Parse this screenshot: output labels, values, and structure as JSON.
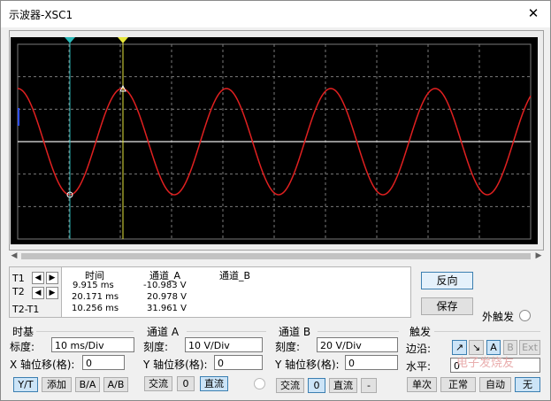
{
  "window": {
    "title": "示波器-XSC1",
    "close": "✕"
  },
  "cursors": {
    "t1_marker": "1",
    "t2_marker": "2"
  },
  "readout": {
    "row_labels": [
      "T1",
      "T2",
      "T2-T1"
    ],
    "headers": {
      "time": "时间",
      "ch_a": "通道_A",
      "ch_b": "通道_B"
    },
    "rows": [
      {
        "time": "9.915 ms",
        "ch_a": "-10.983 V",
        "ch_b": ""
      },
      {
        "time": "20.171 ms",
        "ch_a": "20.978 V",
        "ch_b": ""
      },
      {
        "time": "10.256 ms",
        "ch_a": "31.961 V",
        "ch_b": ""
      }
    ]
  },
  "side_buttons": {
    "reverse": "反向",
    "save": "保存",
    "ext_trigger": "外触发"
  },
  "timebase": {
    "title": "时基",
    "scale_label": "标度:",
    "scale_value": "10 ms/Div",
    "xpos_label": "X 轴位移(格):",
    "xpos_value": "0",
    "modes": [
      "Y/T",
      "添加",
      "B/A",
      "A/B"
    ]
  },
  "channel_a": {
    "title": "通道 A",
    "scale_label": "刻度:",
    "scale_value": "10 V/Div",
    "ypos_label": "Y 轴位移(格):",
    "ypos_value": "0",
    "coupling": [
      "交流",
      "0",
      "直流"
    ]
  },
  "channel_b": {
    "title": "通道 B",
    "scale_label": "刻度:",
    "scale_value": "20 V/Div",
    "ypos_label": "Y 轴位移(格):",
    "ypos_value": "0",
    "coupling": [
      "交流",
      "0",
      "直流",
      "-"
    ]
  },
  "trigger": {
    "title": "触发",
    "edge_label": "边沿:",
    "edge_buttons": [
      "↗",
      "↘",
      "A",
      "B",
      "Ext"
    ],
    "level_label": "水平:",
    "level_value": "0",
    "modes": [
      "单次",
      "正常",
      "自动",
      "无"
    ]
  },
  "watermark": "电子发烧友",
  "colors": {
    "trace_a": "#e02020",
    "trace_b": "#e8e8e8",
    "cursor1": "#2bb8b8",
    "cursor2": "#e6e63c",
    "grid": "#7a7a7a"
  }
}
